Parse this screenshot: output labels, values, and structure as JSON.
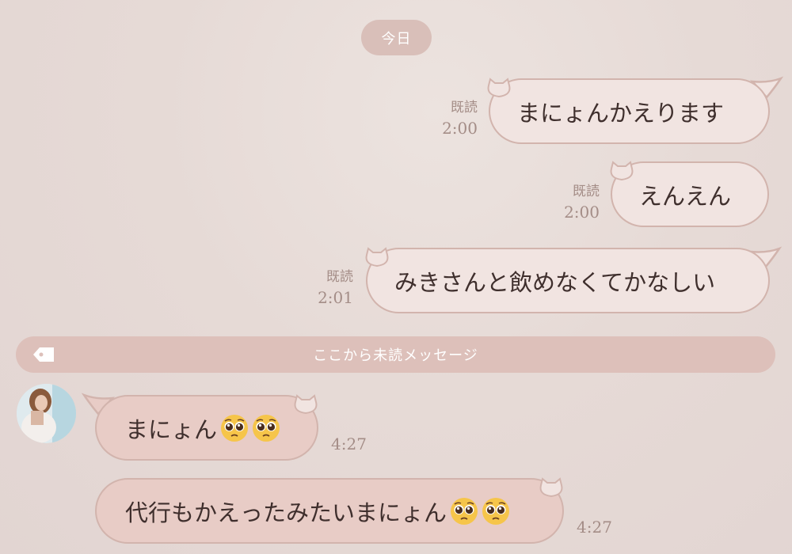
{
  "date_divider": "今日",
  "outgoing": [
    {
      "read": "既読",
      "time": "2:00",
      "text": "まにょんかえります"
    },
    {
      "read": "既読",
      "time": "2:00",
      "text": "えんえん"
    },
    {
      "read": "既読",
      "time": "2:01",
      "text": "みきさんと飲めなくてかなしい"
    }
  ],
  "unread_divider": "ここから未読メッセージ",
  "incoming": [
    {
      "text": "まにょん",
      "emoji_count": 2,
      "emoji": "pleading-face",
      "time": "4:27"
    },
    {
      "text": "代行もかえったみたいまにょん",
      "emoji_count": 2,
      "emoji": "pleading-face",
      "time": "4:27"
    }
  ],
  "colors": {
    "bubble_out": "#f1e4e1",
    "bubble_in": "#e8ccc6",
    "bubble_border": "#d2b4ad",
    "pill": "#d9bfb9",
    "meta_text": "#a48d87"
  }
}
